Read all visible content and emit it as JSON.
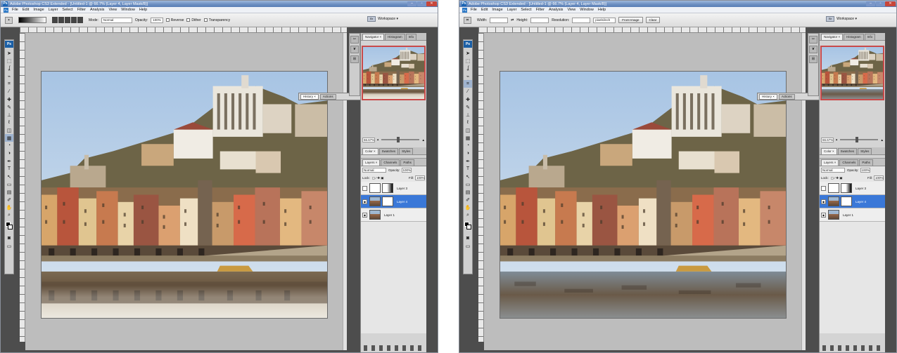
{
  "window_title": "Adobe Photoshop CS3 Extended - [Untitled-1 @ 66.7% (Layer 4, Layer Mask/8)]",
  "app_icon": "Ps",
  "menu": [
    "File",
    "Edit",
    "Image",
    "Layer",
    "Select",
    "Filter",
    "Analysis",
    "View",
    "Window",
    "Help"
  ],
  "left": {
    "options": {
      "mode_label": "Mode:",
      "mode_value": "Normal",
      "opacity_label": "Opacity:",
      "opacity_value": "100%",
      "reverse": "Reverse",
      "dither": "Dither",
      "transparency": "Transparency"
    },
    "workspace": "Workspace ▾",
    "float_tabs": [
      "History ×",
      "Actions"
    ],
    "panel_tabs": [
      "Navigator ×",
      "Histogram",
      "Info"
    ],
    "zoom": "66.67%",
    "color_tabs": [
      "Color ×",
      "Swatches",
      "Styles"
    ],
    "layer_tabs": [
      "Layers ×",
      "Channels",
      "Paths"
    ],
    "blend": "Normal",
    "opacity_label": "Opacity:",
    "opacity": "100%",
    "lock_label": "Lock:",
    "fill_label": "Fill:",
    "fill": "100%",
    "layers": [
      "Layer 3",
      "Layer 4",
      "Layer 1"
    ]
  },
  "right": {
    "options": {
      "width_label": "Width:",
      "height_label": "Height:",
      "resolution_label": "Resolution:",
      "resolution_unit": "pixels/inch",
      "front_image": "Front Image",
      "clear": "Clear"
    },
    "workspace": "Workspace ▾",
    "float_tabs": [
      "History ×",
      "Actions"
    ],
    "panel_tabs": [
      "Navigator ×",
      "Histogram",
      "Info"
    ],
    "zoom": "66.67%",
    "color_tabs": [
      "Color ×",
      "Swatches",
      "Styles"
    ],
    "layer_tabs": [
      "Layers ×",
      "Channels",
      "Paths"
    ],
    "blend": "Normal",
    "opacity_label": "Opacity:",
    "opacity": "100%",
    "lock_label": "Lock:",
    "fill_label": "Fill:",
    "fill": "100%",
    "layers": [
      "Layer 3",
      "Layer 4",
      "Layer 1"
    ]
  },
  "colors": {
    "selection": "#3a78d8",
    "navigator_frame": "#c94a4a",
    "titlebar": "#6a8dc0"
  }
}
